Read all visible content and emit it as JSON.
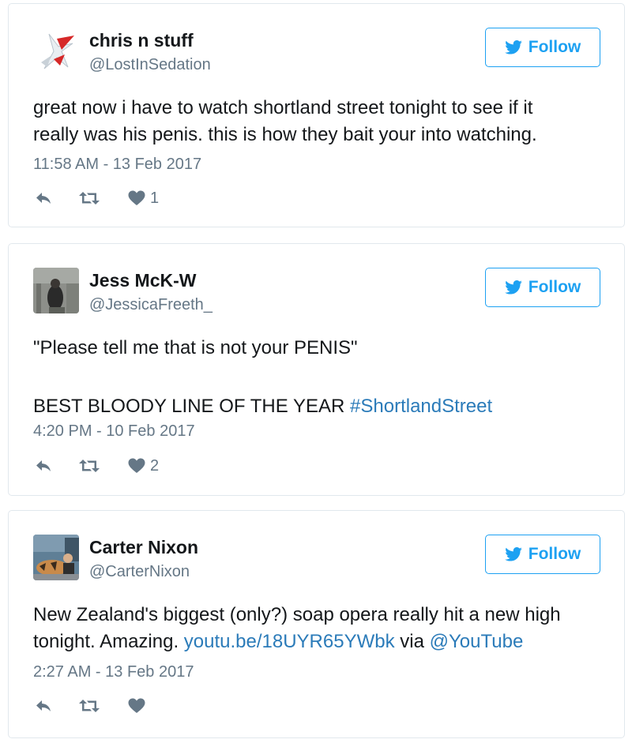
{
  "follow_label": "Follow",
  "colors": {
    "accent": "#1da1f2",
    "link": "#2b7bb9",
    "muted": "#657786",
    "border": "#e1e8ed"
  },
  "tweets": [
    {
      "name": "chris n stuff",
      "handle": "@LostInSedation",
      "text_lines": [
        "great now i have to watch shortland street tonight to see if it",
        "really was his penis. this is how they bait your into watching."
      ],
      "timestamp": "11:58 AM - 13 Feb 2017",
      "like_count": "1"
    },
    {
      "name": "Jess McK-W",
      "handle": "@JessicaFreeth_",
      "quote": "\"Please tell me that is not your PENIS\"",
      "line2_text": "BEST BLOODY LINE OF THE YEAR ",
      "hashtag": "#ShortlandStreet",
      "timestamp": "4:20 PM - 10 Feb 2017",
      "like_count": "2"
    },
    {
      "name": "Carter Nixon",
      "handle": "@CarterNixon",
      "line1": "New Zealand's biggest (only?) soap opera really hit a new high",
      "line2_prefix": "tonight. Amazing. ",
      "link": "youtu.be/18UYR65YWbk",
      "via": " via ",
      "mention": "@YouTube",
      "timestamp": "2:27 AM - 13 Feb 2017",
      "like_count": ""
    }
  ]
}
